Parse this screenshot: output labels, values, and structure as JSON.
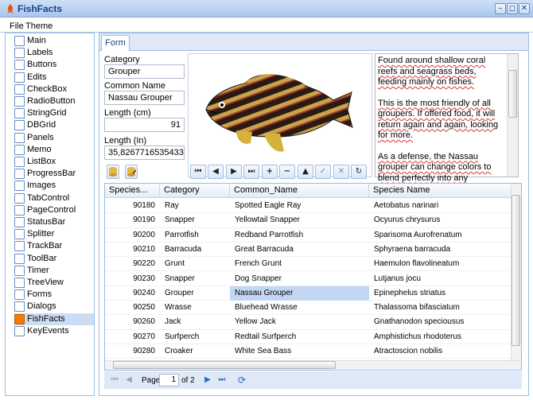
{
  "window": {
    "title": "FishFacts",
    "minimize": "–",
    "restore": "◻",
    "close": "✕"
  },
  "menu": [
    "File",
    "Theme"
  ],
  "sidebar": {
    "items": [
      {
        "label": "Main",
        "icon": "folder-icon"
      },
      {
        "label": "Labels",
        "icon": "label-icon"
      },
      {
        "label": "Buttons",
        "icon": "button-icon"
      },
      {
        "label": "Edits",
        "icon": "edit-icon"
      },
      {
        "label": "CheckBox",
        "icon": "checkbox-icon"
      },
      {
        "label": "RadioButton",
        "icon": "radio-icon"
      },
      {
        "label": "StringGrid",
        "icon": "grid-icon"
      },
      {
        "label": "DBGrid",
        "icon": "dbgrid-icon"
      },
      {
        "label": "Panels",
        "icon": "panel-icon"
      },
      {
        "label": "Memo",
        "icon": "memo-icon"
      },
      {
        "label": "ListBox",
        "icon": "listbox-icon"
      },
      {
        "label": "ProgressBar",
        "icon": "progress-icon"
      },
      {
        "label": "Images",
        "icon": "image-icon"
      },
      {
        "label": "TabControl",
        "icon": "tab-icon"
      },
      {
        "label": "PageControl",
        "icon": "page-icon"
      },
      {
        "label": "StatusBar",
        "icon": "statusbar-icon"
      },
      {
        "label": "Splitter",
        "icon": "splitter-icon"
      },
      {
        "label": "TrackBar",
        "icon": "trackbar-icon"
      },
      {
        "label": "ToolBar",
        "icon": "toolbar-icon"
      },
      {
        "label": "Timer",
        "icon": "timer-icon"
      },
      {
        "label": "TreeView",
        "icon": "treeview-icon"
      },
      {
        "label": "Forms",
        "icon": "forms-icon"
      },
      {
        "label": "Dialogs",
        "icon": "dialogs-icon"
      },
      {
        "label": "FishFacts",
        "icon": "fish-icon",
        "selected": true
      },
      {
        "label": "KeyEvents",
        "icon": "keyboard-icon"
      }
    ]
  },
  "tabs": [
    {
      "label": "Form",
      "active": true
    }
  ],
  "form": {
    "category_label": "Category",
    "category_value": "Grouper",
    "common_name_label": "Common Name",
    "common_name_value": "Nassau Grouper",
    "length_cm_label": "Length (cm)",
    "length_cm_value": "91",
    "length_in_label": "Length (In)",
    "length_in_value": "35,8267716535433"
  },
  "memo": {
    "paragraphs": [
      "Found around shallow coral reefs and seagrass beds, feeding mainly on fishes.",
      "This is the most friendly of all groupers.  If offered food, it will return again and again, looking for more.",
      "As a defense, the Nassau grouper can change colors to blend perfectly into any background"
    ]
  },
  "navigator": [
    "⏮",
    "◀",
    "▶",
    "⏭",
    "+",
    "−",
    "▲",
    "✓",
    "✕",
    "↻"
  ],
  "grid": {
    "columns": [
      "Species...",
      "Category",
      "Common_Name",
      "Species Name"
    ],
    "rows": [
      [
        "90180",
        "Ray",
        "Spotted Eagle Ray",
        "Aetobatus narinari"
      ],
      [
        "90190",
        "Snapper",
        "Yellowtail Snapper",
        "Ocyurus chrysurus"
      ],
      [
        "90200",
        "Parrotfish",
        "Redband Parrotfish",
        "Sparisoma Aurofrenatum"
      ],
      [
        "90210",
        "Barracuda",
        "Great Barracuda",
        "Sphyraena barracuda"
      ],
      [
        "90220",
        "Grunt",
        "French Grunt",
        "Haemulon flavolineatum"
      ],
      [
        "90230",
        "Snapper",
        "Dog Snapper",
        "Lutjanus jocu"
      ],
      [
        "90240",
        "Grouper",
        "Nassau Grouper",
        "Epinephelus striatus"
      ],
      [
        "90250",
        "Wrasse",
        "Bluehead Wrasse",
        "Thalassoma bifasciatum"
      ],
      [
        "90260",
        "Jack",
        "Yellow Jack",
        "Gnathanodon speciousus"
      ],
      [
        "90270",
        "Surfperch",
        "Redtail Surfperch",
        "Amphistichus rhodoterus"
      ],
      [
        "90280",
        "Croaker",
        "White Sea Bass",
        "Atractoscion nobilis"
      ]
    ],
    "selected_row": 6
  },
  "pager": {
    "page_label": "Page",
    "page_value": "1",
    "of_label": "of 2"
  },
  "colors": {
    "accent": "#15428b",
    "border": "#99bbe8",
    "selection": "#c3d6f2"
  }
}
